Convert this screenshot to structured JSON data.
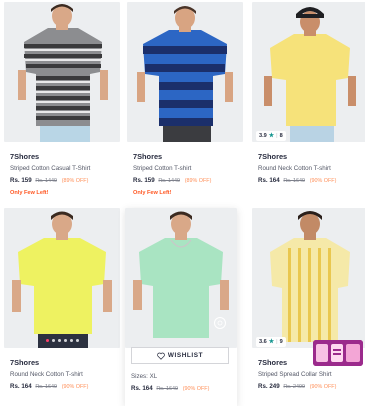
{
  "products": [
    {
      "brand": "7Shores",
      "name": "Striped Cotton Casual T-Shirt",
      "price": "Rs. 159",
      "mrp": "Rs. 1449",
      "discount": "(89% OFF)",
      "note": "Only Few Left!",
      "shirt_color": "#8c8d90"
    },
    {
      "brand": "7Shores",
      "name": "Striped Cotton T-shirt",
      "price": "Rs. 159",
      "mrp": "Rs. 1449",
      "discount": "(89% OFF)",
      "note": "Only Few Left!",
      "shirt_color": "#2c66c4"
    },
    {
      "brand": "7Shores",
      "name": "Round Neck Cotton T-shirt",
      "price": "Rs. 164",
      "mrp": "Rs. 1649",
      "discount": "(90% OFF)",
      "rating": "3.9",
      "rating_count": "8",
      "shirt_color": "#f6e27a"
    },
    {
      "brand": "7Shores",
      "name": "Round Neck Cotton T-shirt",
      "price": "Rs. 164",
      "mrp": "Rs. 1649",
      "discount": "(90% OFF)",
      "shirt_color": "#eef261"
    },
    {
      "sizes_label": "Sizes: XL",
      "price": "Rs. 164",
      "mrp": "Rs. 1649",
      "discount": "(90% OFF)",
      "shirt_color": "#a9e4c2",
      "wishlist_label": "WISHLIST"
    },
    {
      "brand": "7Shores",
      "name": "Striped Spread Collar Shirt",
      "price": "Rs. 249",
      "mrp": "Rs. 2499",
      "discount": "(90% OFF)",
      "rating": "3.6",
      "rating_count": "9",
      "shirt_color": "#f5e9a8"
    }
  ],
  "colors": {
    "accent": "#ff3f6c",
    "discount": "#ff905a",
    "few_left": "#ff5722",
    "rating_star": "#14958f"
  }
}
